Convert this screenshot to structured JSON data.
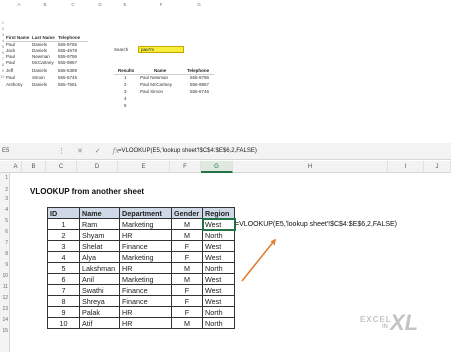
{
  "top_sheet": {
    "col_headers": [
      "A",
      "B",
      "C",
      "D",
      "E",
      "F",
      "G"
    ],
    "table_headers": [
      "First Name",
      "Last Name",
      "Telephone"
    ],
    "rows": [
      [
        "Paul",
        "Daniels",
        "555-9765"
      ],
      [
        "Jack",
        "Daniels",
        "555-4678"
      ],
      [
        "Paul",
        "Newman",
        "555-9756"
      ],
      [
        "Paul",
        "McCartney",
        "555-9867"
      ],
      [
        "Jeff",
        "Daniels",
        "555-6389"
      ],
      [
        "Paul",
        "Simon",
        "555-6745"
      ],
      [
        "Anthony",
        "Daniels",
        "555-7561"
      ]
    ],
    "search_label": "Search",
    "search_value": "pau*m",
    "results_label": "Results",
    "results_headers": [
      "Name",
      "Telephone"
    ],
    "results": [
      [
        "1",
        "Paul Newman",
        "555-9756"
      ],
      [
        "2",
        "Paul McCartney",
        "555-9867"
      ],
      [
        "3",
        "Paul Simon",
        "555-6745"
      ],
      [
        "4",
        "",
        ""
      ],
      [
        "5",
        "",
        ""
      ]
    ]
  },
  "excel": {
    "namebox": "E5",
    "toolbar_icons": [
      "more-options-icon",
      "cancel-icon",
      "enter-check-icon",
      "function-icon"
    ],
    "formula": "=VLOOKUP(E5,'lookup sheet'!$C$4:$E$6,2,FALSE)",
    "columns": [
      "A",
      "B",
      "C",
      "D",
      "E",
      "F",
      "G",
      "H",
      "I",
      "J"
    ],
    "selected_column": "G",
    "row_numbers": [
      "1",
      "2",
      "3",
      "4",
      "5",
      "6",
      "7",
      "8",
      "9",
      "10",
      "11",
      "12",
      "13",
      "14",
      "15"
    ],
    "title": "VLOOKUP from another sheet",
    "table_headers": [
      "ID",
      "Name",
      "Department",
      "Gender",
      "Region"
    ],
    "table_rows": [
      [
        "1",
        "Ram",
        "Marketing",
        "M",
        "West"
      ],
      [
        "2",
        "Shyam",
        "HR",
        "M",
        "North"
      ],
      [
        "3",
        "Shelat",
        "Finance",
        "F",
        "West"
      ],
      [
        "4",
        "Alya",
        "Marketing",
        "F",
        "West"
      ],
      [
        "5",
        "Lakshman",
        "HR",
        "M",
        "North"
      ],
      [
        "6",
        "Anil",
        "Marketing",
        "M",
        "West"
      ],
      [
        "7",
        "Swathi",
        "Finance",
        "F",
        "West"
      ],
      [
        "8",
        "Shreya",
        "Finance",
        "F",
        "West"
      ],
      [
        "9",
        "Palak",
        "HR",
        "F",
        "North"
      ],
      [
        "10",
        "Atif",
        "HR",
        "M",
        "North"
      ]
    ],
    "formula_note": "=VLOOKUP(E5,'lookup sheet'!$C$4:$E$6,2,FALSE)",
    "logo": {
      "excel": "EXCEL",
      "in": "IN",
      "xl": "XL"
    }
  }
}
